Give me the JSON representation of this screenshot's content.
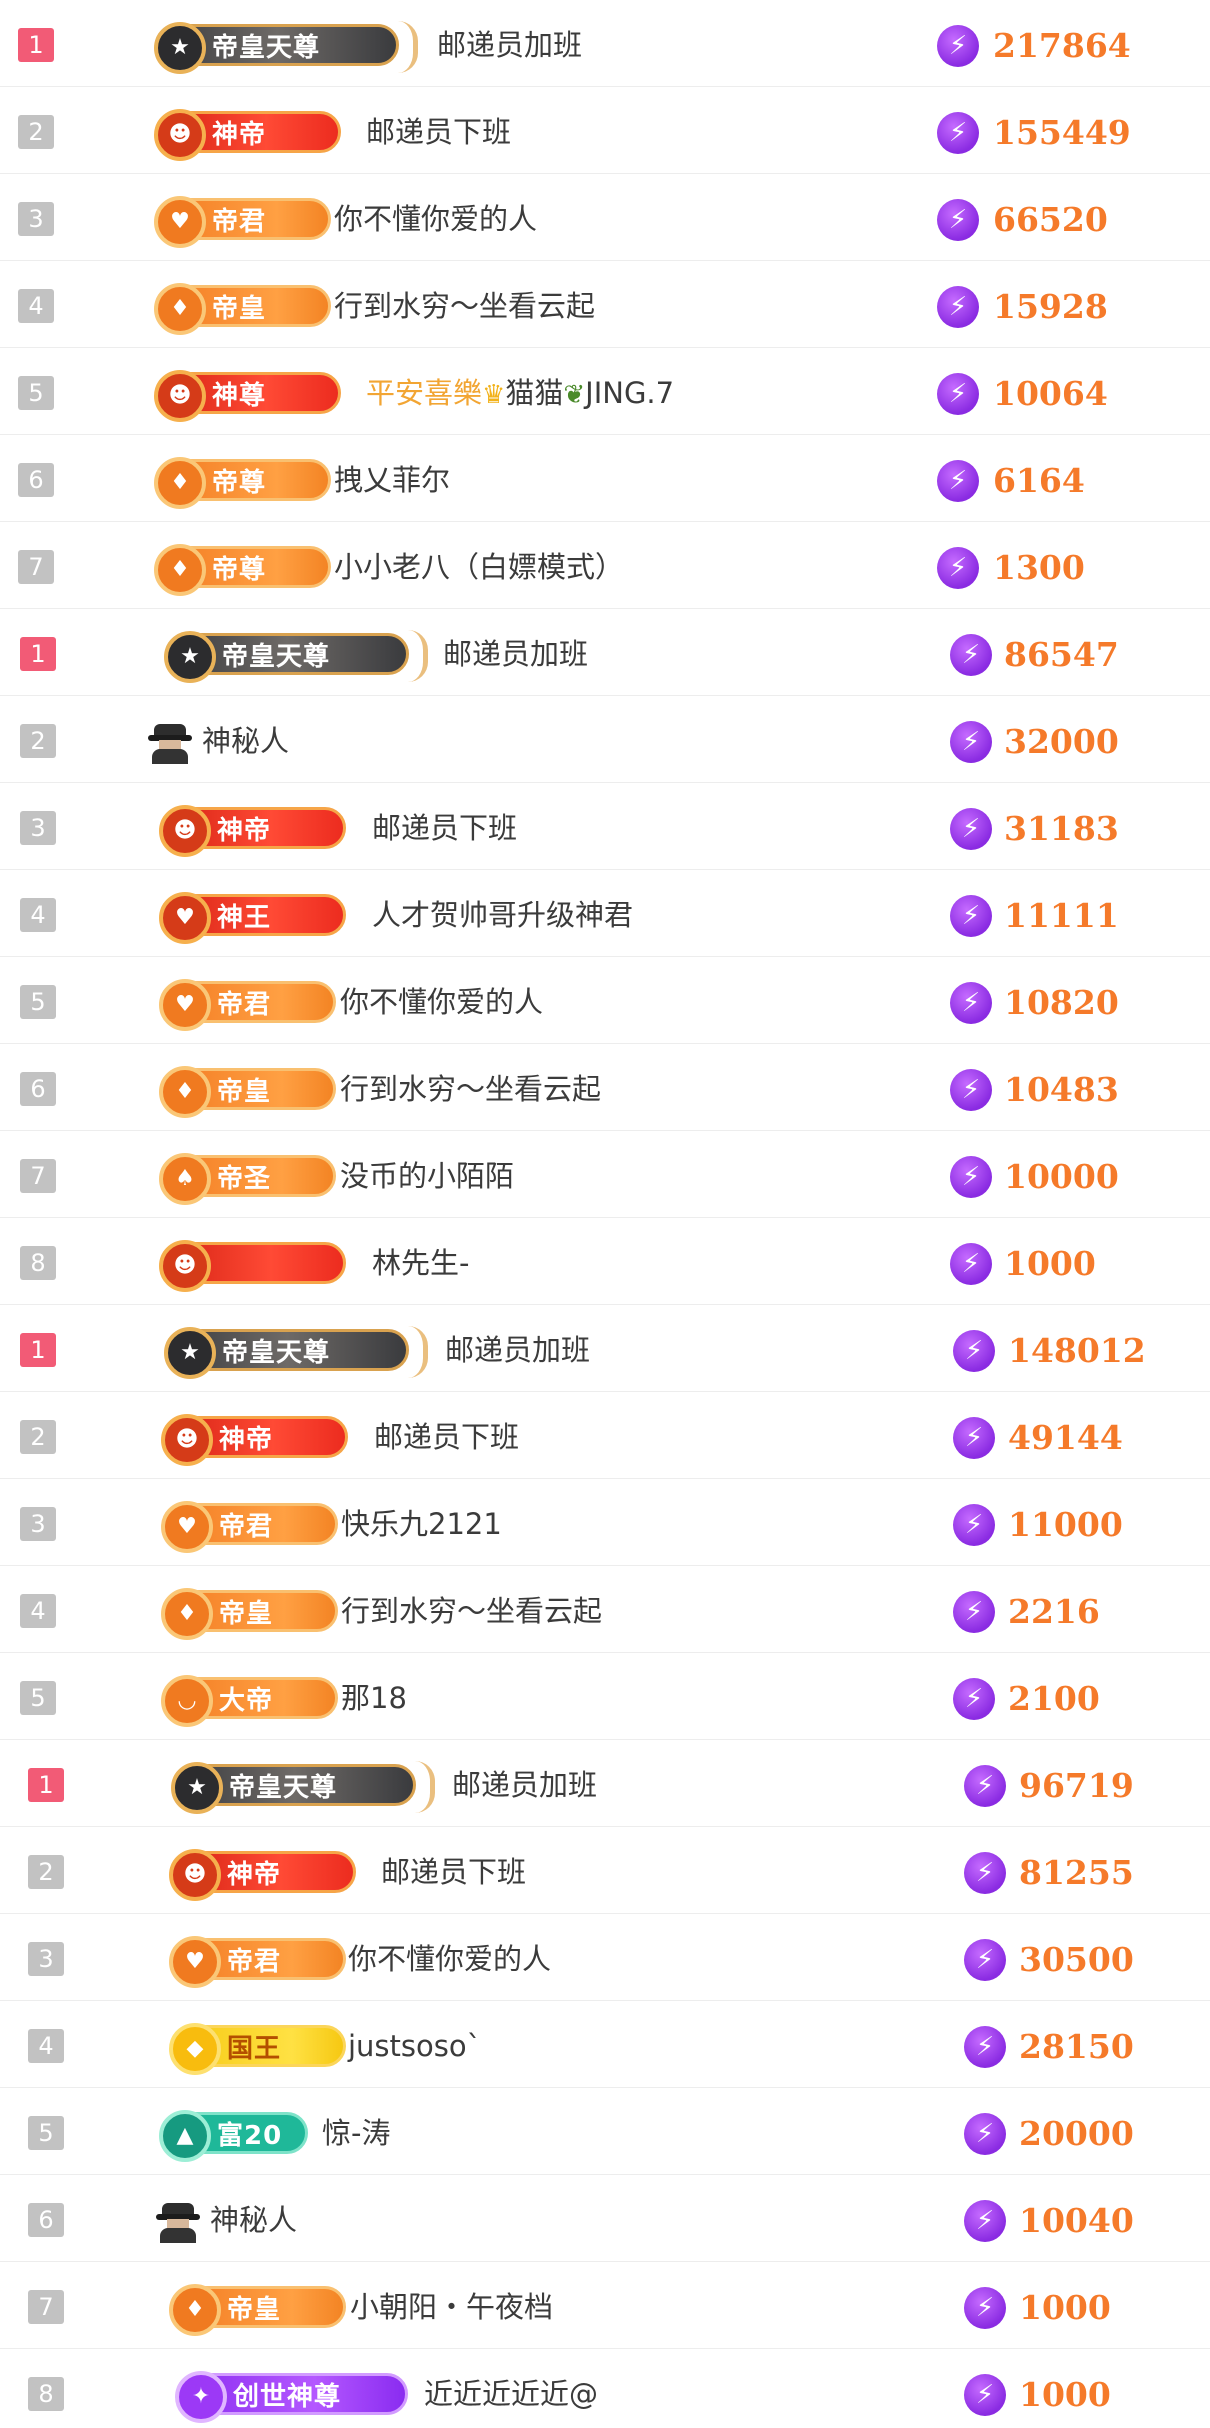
{
  "boards": [
    [
      {
        "rank": "1",
        "badge": "帝皇天尊",
        "name": "邮递员加班",
        "score": "217864"
      },
      {
        "rank": "2",
        "badge": "神帝",
        "name": "邮递员下班",
        "score": "155449"
      },
      {
        "rank": "3",
        "badge": "帝君",
        "name": "你不懂你爱的人",
        "score": "66520"
      },
      {
        "rank": "4",
        "badge": "帝皇",
        "name": "行到水穷～坐看云起",
        "score": "15928"
      },
      {
        "rank": "5",
        "badge": "神尊",
        "name": "平安喜樂",
        "name2": "猫猫",
        "name3": "JING.7",
        "score": "10064"
      },
      {
        "rank": "6",
        "badge": "帝尊",
        "name": "拽乂菲尔",
        "score": "6164"
      },
      {
        "rank": "7",
        "badge": "帝尊",
        "name": "小小老八（白嫖模式）",
        "score": "1300"
      }
    ],
    [
      {
        "rank": "1",
        "badge": "帝皇天尊",
        "name": "邮递员加班",
        "score": "86547"
      },
      {
        "rank": "2",
        "badge": "",
        "name": "神秘人",
        "score": "32000"
      },
      {
        "rank": "3",
        "badge": "神帝",
        "name": "邮递员下班",
        "score": "31183"
      },
      {
        "rank": "4",
        "badge": "神王",
        "name": "人才贺帅哥升级神君",
        "score": "11111"
      },
      {
        "rank": "5",
        "badge": "帝君",
        "name": "你不懂你爱的人",
        "score": "10820"
      },
      {
        "rank": "6",
        "badge": "帝皇",
        "name": "行到水穷～坐看云起",
        "score": "10483"
      },
      {
        "rank": "7",
        "badge": "帝圣",
        "name": "没币的小陌陌",
        "score": "10000"
      },
      {
        "rank": "8",
        "badge": "",
        "name": "林先生-",
        "score": "1000"
      }
    ],
    [
      {
        "rank": "1",
        "badge": "帝皇天尊",
        "name": "邮递员加班",
        "score": "148012"
      },
      {
        "rank": "2",
        "badge": "神帝",
        "name": "邮递员下班",
        "score": "49144"
      },
      {
        "rank": "3",
        "badge": "帝君",
        "name": "快乐九2121",
        "score": "11000"
      },
      {
        "rank": "4",
        "badge": "帝皇",
        "name": "行到水穷～坐看云起",
        "score": "2216"
      },
      {
        "rank": "5",
        "badge": "大帝",
        "name": "那18",
        "score": "2100"
      }
    ],
    [
      {
        "rank": "1",
        "badge": "帝皇天尊",
        "name": "邮递员加班",
        "score": "96719"
      },
      {
        "rank": "2",
        "badge": "神帝",
        "name": "邮递员下班",
        "score": "81255"
      },
      {
        "rank": "3",
        "badge": "帝君",
        "name": "你不懂你爱的人",
        "score": "30500"
      },
      {
        "rank": "4",
        "badge": "国王",
        "name": "justsoso`",
        "score": "28150"
      },
      {
        "rank": "5",
        "badge": "富20",
        "name": "惊-涛",
        "score": "20000"
      },
      {
        "rank": "6",
        "badge": "",
        "name": "神秘人",
        "score": "10040"
      },
      {
        "rank": "7",
        "badge": "帝皇",
        "name": "小朝阳・午夜档",
        "score": "1000"
      },
      {
        "rank": "8",
        "badge": "创世神尊",
        "name": "近近近近近@",
        "score": "1000"
      }
    ]
  ],
  "icons": {
    "rank_top_color": "#f25b76",
    "rank_color": "#c2c2c2",
    "score_color": "#f57a2a",
    "bolt_color": "#8a2be2",
    "medal_icon": "medal-icon",
    "star_icon": "star-icon",
    "bolt_icon": "lightning-bolt-icon",
    "crown_icon": "crown-icon",
    "sprout_icon": "sprout-icon",
    "mystery_icon": "mystery-person-icon"
  }
}
